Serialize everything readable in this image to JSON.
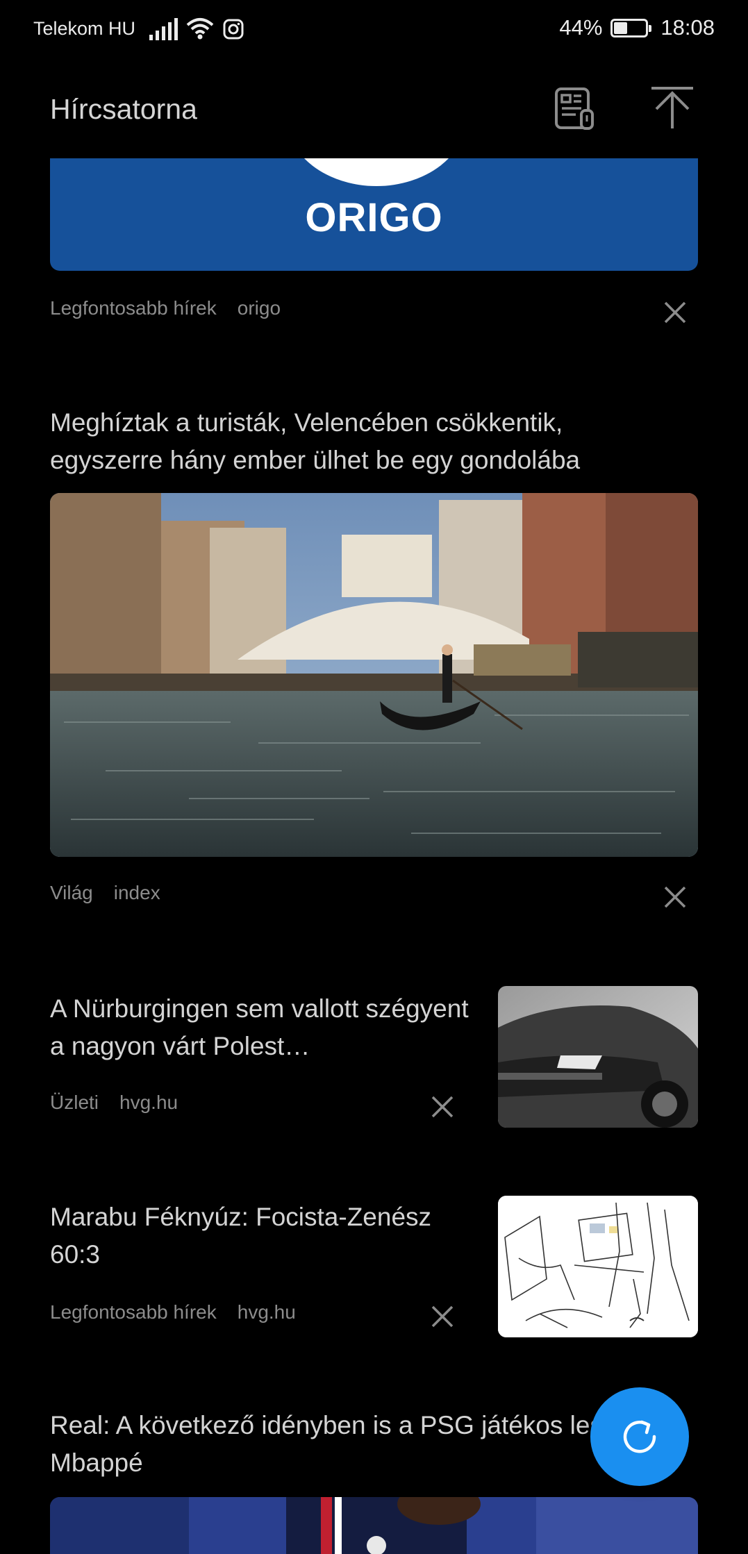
{
  "status_bar": {
    "carrier": "Telekom HU",
    "battery_percent": "44%",
    "battery_level": 0.44,
    "time": "18:08",
    "icons": [
      "signal-icon",
      "wifi-icon",
      "instagram-icon",
      "battery-icon"
    ]
  },
  "header": {
    "title": "Hírcsatorna",
    "buttons": [
      "news-manage-icon",
      "scroll-top-icon"
    ]
  },
  "feed": {
    "items": [
      {
        "logo_text": "ORIGO",
        "category": "Legfontosabb hírek",
        "source": "origo"
      },
      {
        "title": "Meghíztak a turisták, Velencében csökkentik, egyszerre hány ember ülhet be egy gondolába",
        "category": "Világ",
        "source": "index"
      },
      {
        "title": "A Nürburgingen sem vallott szégyent a nagyon várt Polest…",
        "category": "Üzleti",
        "source": "hvg.hu"
      },
      {
        "title": "Marabu Féknyúz: Focista-Zenész 60:3",
        "category": "Legfontosabb hírek",
        "source": "hvg.hu"
      },
      {
        "title": "Real: A következő idényben is a PSG játékos leszek – Mbappé"
      }
    ]
  },
  "fab": {
    "icon": "refresh-icon"
  },
  "colors": {
    "background": "#000000",
    "origo_blue": "#16519a",
    "fab_blue": "#1a8ff0",
    "meta_gray": "#8c8c8c"
  }
}
